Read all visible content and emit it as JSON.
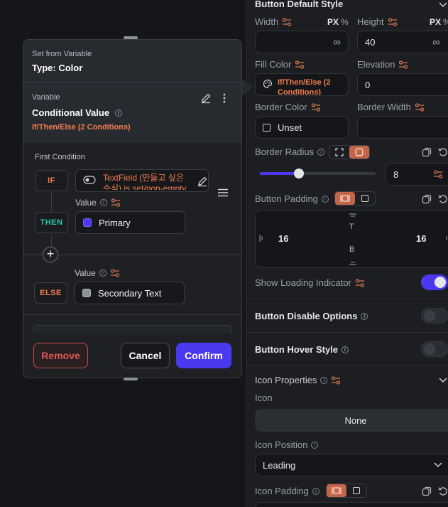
{
  "props": {
    "section_title": "Button Default Style",
    "width_label": "Width",
    "height_label": "Height",
    "unit_px": "PX",
    "unit_pct": "%",
    "width_value": "∞",
    "height_value": "40",
    "height_suffix": "∞",
    "fill_color_label": "Fill Color",
    "fill_color_value": "If/Then/Else (2 Conditions)",
    "elevation_label": "Elevation",
    "elevation_value": "0",
    "border_color_label": "Border Color",
    "border_color_value": "Unset",
    "border_width_label": "Border Width",
    "border_radius_label": "Border Radius",
    "border_radius_value": "8",
    "border_radius_slider_fraction": 0.34,
    "padding_label": "Button Padding",
    "padding_left": "16",
    "padding_right": "16",
    "padding_top": "T",
    "padding_bottom": "B",
    "loading_label": "Show Loading Indicator",
    "loading_on": true,
    "disable_label": "Button Disable Options",
    "hover_label": "Button Hover Style",
    "icon_props_label": "Icon Properties",
    "icon_label": "Icon",
    "icon_value": "None",
    "icon_position_label": "Icon Position",
    "icon_position_value": "Leading",
    "icon_padding_label": "Icon Padding"
  },
  "dialog": {
    "header_small": "Set from Variable",
    "header_title": "Type: Color",
    "variable_small": "Variable",
    "variable_title": "Conditional Value",
    "variable_summary": "If/Then/Else (2 Conditions)",
    "first_condition_label": "First Condition",
    "if_label": "IF",
    "if_condition_text": "TextField (만들고 싶은 수식) is set/non-empty",
    "then_label": "THEN",
    "then_value_label": "Value",
    "then_value": "Primary",
    "else_label": "ELSE",
    "else_value_label": "Value",
    "else_value": "Secondary Text",
    "remove_label": "Remove",
    "cancel_label": "Cancel",
    "confirm_label": "Confirm"
  },
  "colors": {
    "accent": "#4B39EF",
    "orange": "#F07E4F",
    "teal": "#2FC5A8",
    "remove_red": "#E05757",
    "primary_swatch": "#4B39EF",
    "secondary_swatch": "#9AA0A8"
  }
}
